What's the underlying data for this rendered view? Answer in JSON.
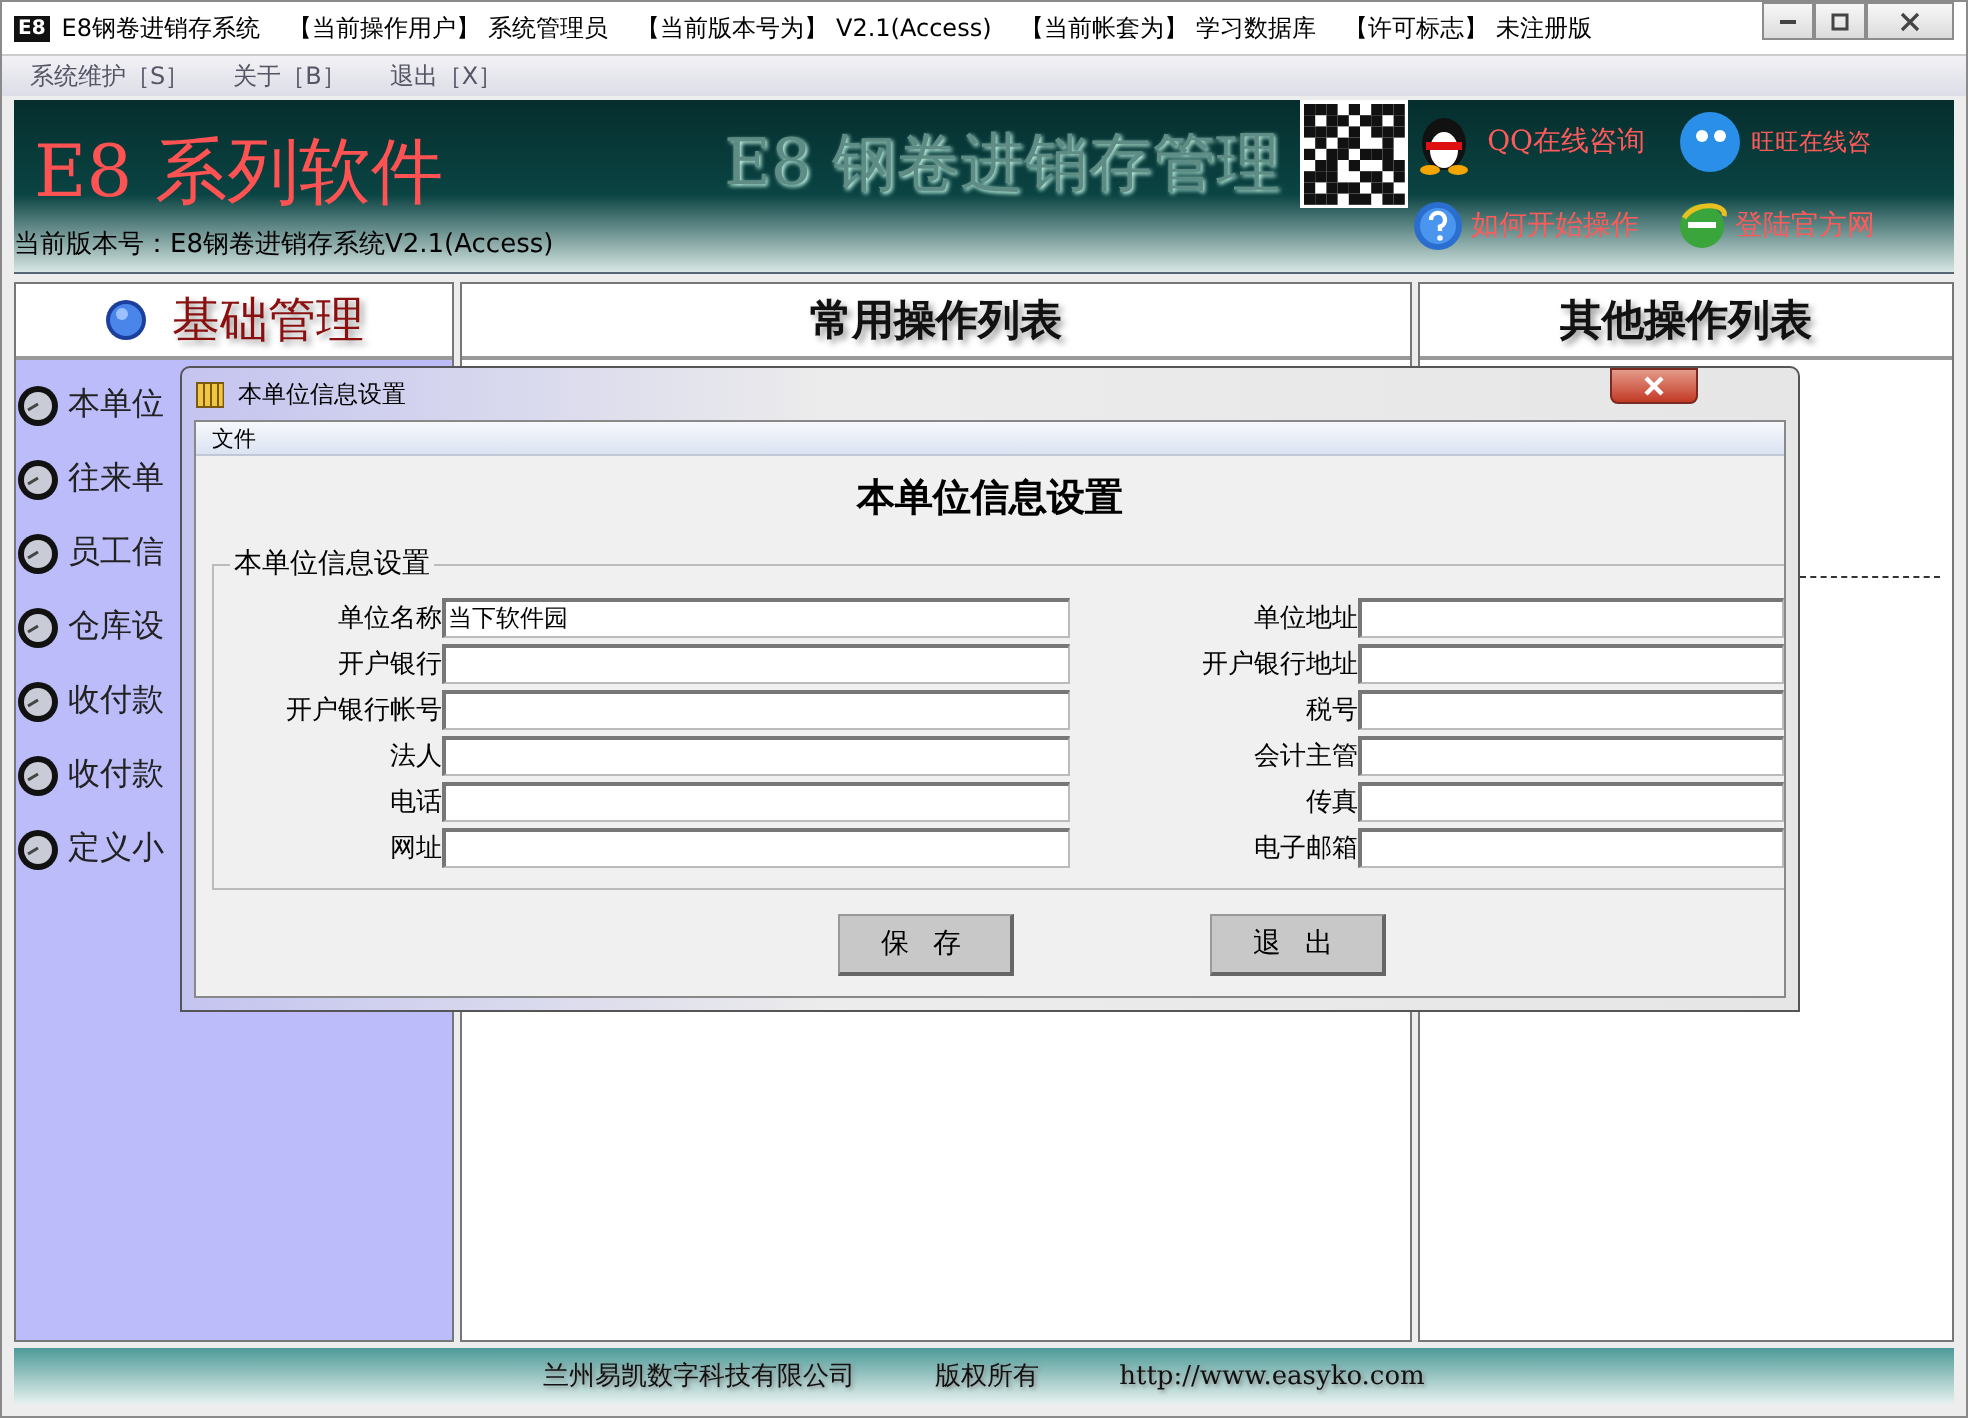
{
  "window": {
    "app_icon": "E8",
    "title": "E8钢卷进销存系统",
    "status": [
      {
        "label": "【当前操作用户】",
        "value": "系统管理员"
      },
      {
        "label": "【当前版本号为】",
        "value": "V2.1(Access)"
      },
      {
        "label": "【当前帐套为】",
        "value": "学习数据库"
      },
      {
        "label": "【许可标志】",
        "value": "未注册版"
      }
    ]
  },
  "menu": [
    "系统维护［S］",
    "关于［B］",
    "退出［X］"
  ],
  "banner": {
    "brand": "E8 系列软件",
    "product": "E8 钢卷进销存管理",
    "version": "当前版本号：E8钢卷进销存系统V2.1(Access)",
    "links": [
      {
        "kind": "qq",
        "label": "QQ在线咨询"
      },
      {
        "kind": "wangwang",
        "label": "旺旺在线咨"
      },
      {
        "kind": "help",
        "label": "如何开始操作"
      },
      {
        "kind": "web",
        "label": "登陆官方网"
      }
    ]
  },
  "panels": [
    {
      "title": "基础管理",
      "items": [
        "本单位",
        "往来单",
        "员工信",
        "仓库设",
        "收付款",
        "收付款",
        "定义小"
      ]
    },
    {
      "title": "常用操作列表"
    },
    {
      "title": "其他操作列表"
    }
  ],
  "dialog": {
    "title": "本单位信息设置",
    "menu": [
      "文件"
    ],
    "heading": "本单位信息设置",
    "group": "本单位信息设置",
    "fields": [
      {
        "label": "单位名称",
        "value": "当下软件园"
      },
      {
        "label": "单位地址"
      },
      {
        "label": "开户银行"
      },
      {
        "label": "开户银行地址"
      },
      {
        "label": "开户银行帐号"
      },
      {
        "label": "税号"
      },
      {
        "label": "法人"
      },
      {
        "label": "会计主管"
      },
      {
        "label": "电话"
      },
      {
        "label": "传真"
      },
      {
        "label": "网址"
      },
      {
        "label": "电子邮箱"
      }
    ],
    "buttons": [
      "保 存",
      "退 出"
    ]
  },
  "footer": [
    "兰州易凯数字科技有限公司",
    "版权所有",
    "http://www.easyko.com"
  ]
}
